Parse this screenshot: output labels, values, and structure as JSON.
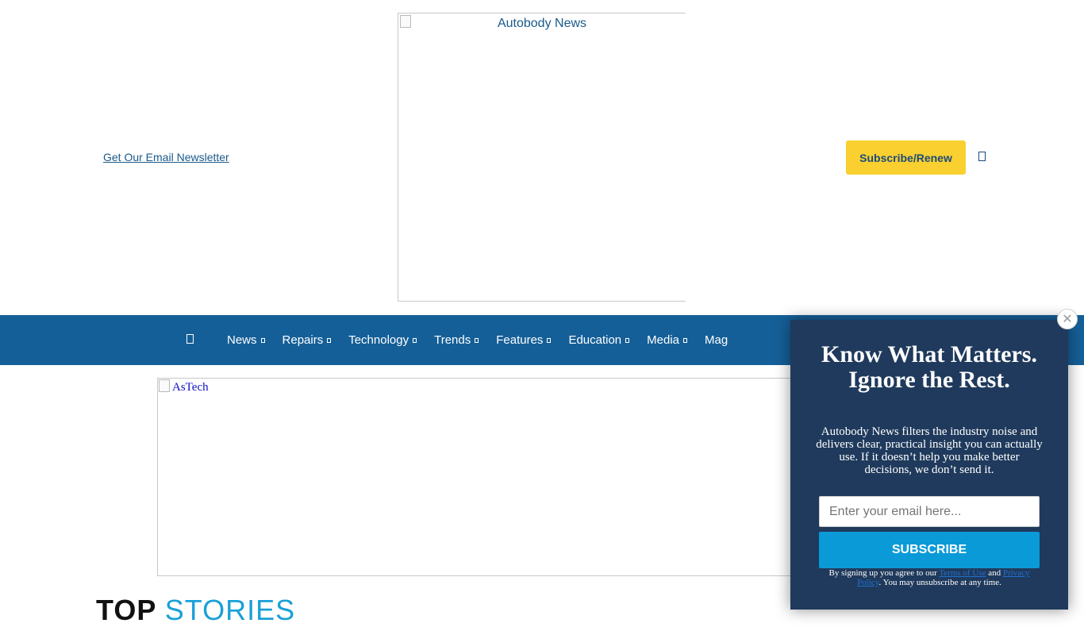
{
  "header": {
    "newsletter_link": "Get Our Email Newsletter",
    "logo_alt": "Autobody News",
    "subscribe_label": "Subscribe/Renew",
    "search_icon": "search-icon"
  },
  "nav": {
    "home_icon": "home-icon",
    "items": [
      {
        "label": "News"
      },
      {
        "label": "Repairs"
      },
      {
        "label": "Technology"
      },
      {
        "label": "Trends"
      },
      {
        "label": "Features"
      },
      {
        "label": "Education"
      },
      {
        "label": "Media"
      },
      {
        "label": "Mag"
      }
    ]
  },
  "ad": {
    "alt": "AsTech"
  },
  "section": {
    "title_a": "TOP ",
    "title_b": "STORIES"
  },
  "popup": {
    "close_glyph": "✕",
    "title": "Know What Matters. Ignore the Rest.",
    "body": "Autobody News filters the industry noise and delivers clear, practical insight you can actually use. If it doesn’t help you make better decisions, we don’t send it.",
    "email_placeholder": "Enter your email here...",
    "submit_label": "SUBSCRIBE",
    "legal_prefix": "By signing up you agree to our ",
    "terms_link": "Terms of Use",
    "legal_and": " and ",
    "privacy_link": "Privacy Policy",
    "legal_suffix": ". You may unsubscribe at any time."
  },
  "colors": {
    "nav_bg": "#155f98",
    "subscribe_btn": "#f9d030",
    "popup_bg": "#1f3a5c",
    "popup_submit": "#0a9ad8",
    "stories_accent": "#1aa0d8"
  }
}
